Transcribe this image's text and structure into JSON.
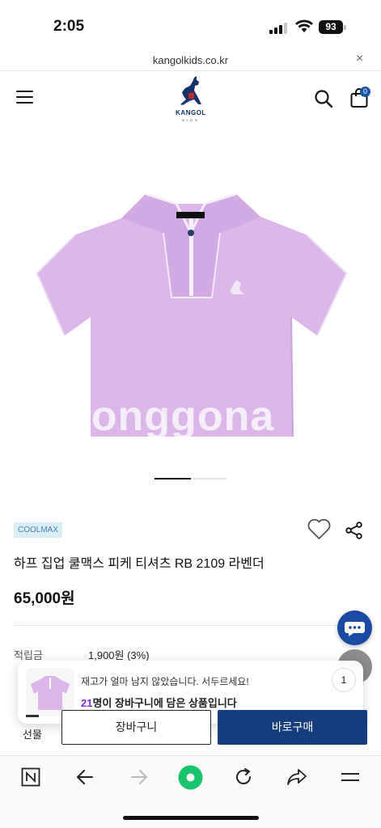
{
  "status_bar": {
    "time": "2:05",
    "battery": "93"
  },
  "browser": {
    "url": "kangolkids.co.kr",
    "close_icon": "×"
  },
  "header": {
    "logo_text": "KANGOL",
    "logo_sub": "KIDS",
    "cart_count": "0"
  },
  "product": {
    "watermark": "bonggona",
    "badge": "COOLMAX",
    "title": "하프 집업 쿨맥스 피케 티셔츠 RB 2109 라벤더",
    "price": "65,000원",
    "points_label": "적립금",
    "points_value": "1,900원 (3%)",
    "image_slide": 0.5,
    "color": "#dcb6ea"
  },
  "toast": {
    "line1": "재고가 얼마 남지 않았습니다. 서두르세요!",
    "count": "21",
    "line2_suffix": "명이 장바구니에 담은 상품입니다",
    "badge": "1"
  },
  "purchase_bar": {
    "gift": "선물",
    "cart": "장바구니",
    "buy": "바로구매"
  },
  "toolbar": {
    "items": [
      "n-icon",
      "back-icon",
      "forward-icon",
      "home-icon",
      "reload-icon",
      "share-icon",
      "menu-icon"
    ]
  }
}
